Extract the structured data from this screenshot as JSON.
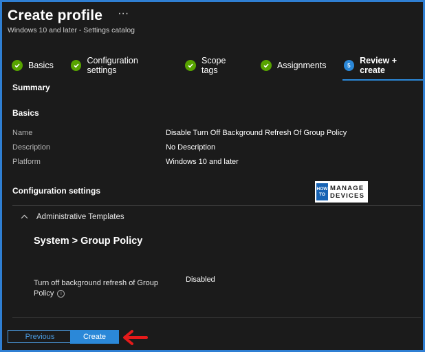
{
  "header": {
    "title": "Create profile",
    "more_icon": "ellipsis-icon",
    "subtitle": "Windows 10 and later - Settings catalog"
  },
  "steps": [
    {
      "label": "Basics",
      "status": "complete"
    },
    {
      "label": "Configuration settings",
      "status": "complete"
    },
    {
      "label": "Scope tags",
      "status": "complete"
    },
    {
      "label": "Assignments",
      "status": "complete"
    },
    {
      "label": "Review + create",
      "status": "active",
      "number": "5"
    }
  ],
  "summary": {
    "heading": "Summary",
    "basics_heading": "Basics",
    "fields": [
      {
        "label": "Name",
        "value": "Disable Turn Off Background Refresh Of Group Policy"
      },
      {
        "label": "Description",
        "value": "No Description"
      },
      {
        "label": "Platform",
        "value": "Windows 10 and later"
      }
    ],
    "config_heading": "Configuration settings"
  },
  "logo": {
    "how": "HOW",
    "to": "TO",
    "line1": "MANAGE",
    "line2": "DEVICES"
  },
  "config": {
    "accordion_label": "Administrative Templates",
    "group_title": "System > Group Policy",
    "setting_name": "Turn off background refresh of Group Policy",
    "setting_value": "Disabled"
  },
  "footer": {
    "previous_label": "Previous",
    "create_label": "Create"
  },
  "colors": {
    "accent": "#2b88d8",
    "check": "#57a300",
    "background": "#1b1b1b",
    "frame": "#2f7fd3",
    "arrow": "#e51a1a"
  }
}
